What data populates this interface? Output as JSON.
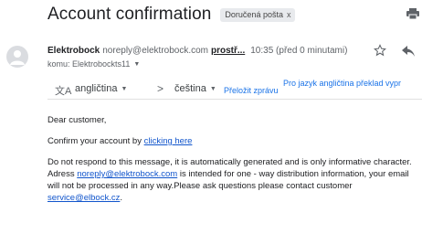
{
  "email": {
    "subject": "Account confirmation",
    "label_chip": "Doručená pošta",
    "label_chip_close": "x",
    "sender_name": "Elektrobock",
    "sender_email": "noreply@elektrobock.com",
    "sender_more": "prostř...",
    "time": "10:35 (před 0 minutami)",
    "to_line": "komu: Elektrobockts11"
  },
  "translate": {
    "from_lang": "angličtina",
    "arrow": ">",
    "to_lang": "čeština",
    "translate_button": "Přeložit zprávu",
    "always_translate": "Pro jazyk angličtina překlad vypr"
  },
  "body": {
    "greeting": "Dear customer,",
    "confirm_prefix": "Confirm your account by ",
    "confirm_link": "clicking here",
    "notice_part1": "Do not respond to this message, it is automatically generated and is only informative character. Adress ",
    "notice_link1": "noreply@elektrobock.com",
    "notice_part2": " is intended for one - way distribution information, your email will not be processed in any way.Please ask questions please contact customer ",
    "notice_link2": "service@elbock.cz",
    "notice_end": "."
  },
  "icons": {
    "print": "printer-icon",
    "star": "star-icon",
    "reply": "reply-icon",
    "avatar": "person-icon",
    "translate": "translate-icon"
  }
}
